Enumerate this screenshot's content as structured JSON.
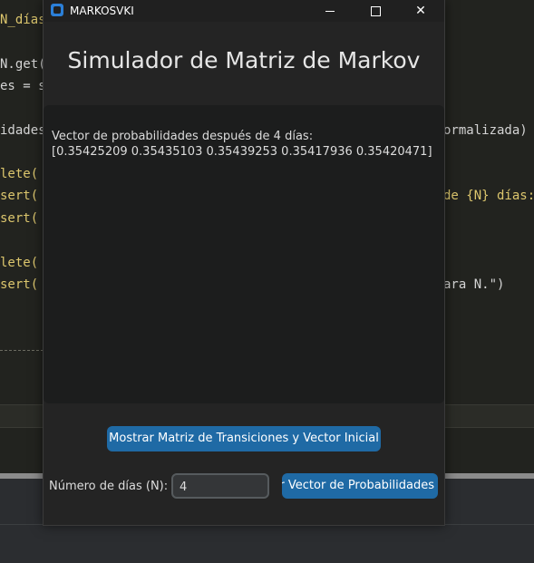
{
  "editor": {
    "lines": [
      {
        "text": "N_días",
        "color": "#dcc66d"
      },
      {
        "text": "N.get(",
        "color": "#d4d4d4"
      },
      {
        "text": "es = s",
        "color": "#d4d4d4"
      },
      {
        "text": "idades",
        "color": "#d4d4d4"
      },
      {
        "text": "lete(",
        "color": "#dcc66d"
      },
      {
        "text": "sert(",
        "color": "#dcc66d"
      },
      {
        "text": "sert(",
        "color": "#dcc66d"
      },
      {
        "text": "lete(",
        "color": "#dcc66d"
      },
      {
        "text": "sert(",
        "color": "#dcc66d"
      },
      {
        "text": "ormalizada)",
        "color": "#d4d4d4"
      },
      {
        "text": "de {N} días:\\",
        "color": "#dcc66d"
      },
      {
        "text": "ara N.\")",
        "color": "#d4d4d4"
      }
    ]
  },
  "window": {
    "title": "MARKOSVKI",
    "controls": {
      "minimize": "",
      "maximize": "",
      "close": "✕"
    }
  },
  "app": {
    "heading": "Simulador de Matriz de Markov",
    "output": {
      "line1": "Vector de probabilidades después de 4 días:",
      "line2": "[0.35425209 0.35435103 0.35439253 0.35417936 0.35420471]"
    },
    "show_matrix_button": "Mostrar Matriz de Transiciones y Vector Inicial",
    "n_label": "Número de días (N):",
    "n_value": "4",
    "show_vector_button": "Mostrar Vector de Probabilidades"
  },
  "colors": {
    "accent": "#1f6aa5",
    "window_bg": "#242424",
    "output_bg": "#1c1d1d"
  }
}
